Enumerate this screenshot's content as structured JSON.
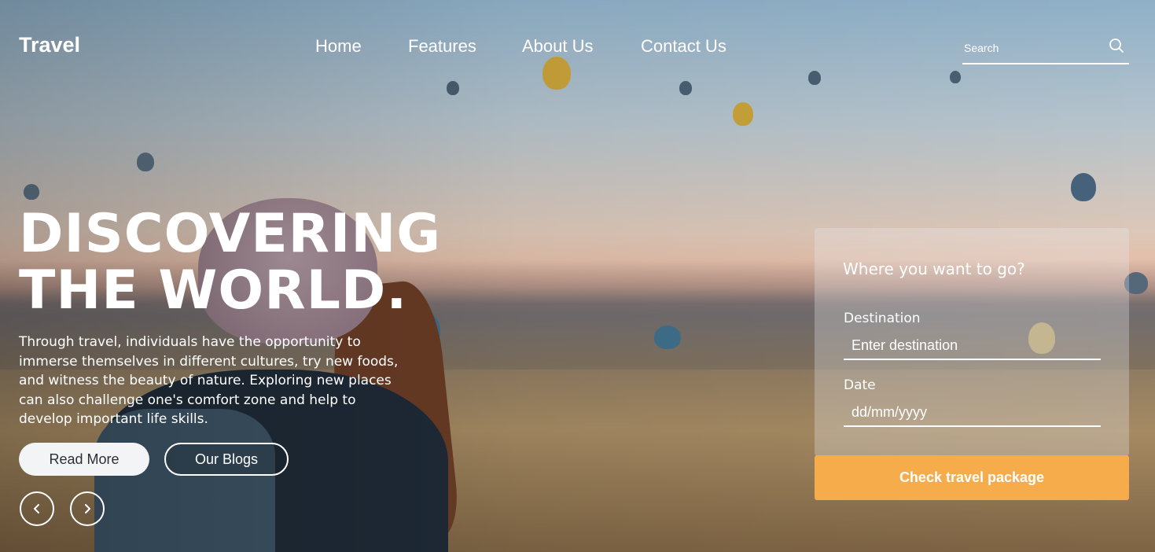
{
  "brand": {
    "logo": "Travel"
  },
  "nav": {
    "items": [
      "Home",
      "Features",
      "About Us",
      "Contact Us"
    ]
  },
  "search": {
    "placeholder": "Search"
  },
  "hero": {
    "headline_line1": "DISCOVERING",
    "headline_line2": "THE WORLD.",
    "description": "Through travel, individuals have the opportunity to immerse themselves in different cultures, try new foods, and witness the beauty of nature. Exploring new places can also challenge one's comfort zone and help to develop important life skills.",
    "read_more_label": "Read More",
    "blogs_label": "Our Blogs",
    "prev_icon": "chevron-left-icon",
    "next_icon": "chevron-right-icon"
  },
  "booking": {
    "title": "Where you want to go?",
    "destination_label": "Destination",
    "destination_placeholder": "Enter destination",
    "date_label": "Date",
    "date_placeholder": "dd/mm/yyyy",
    "submit_label": "Check travel package"
  },
  "colors": {
    "accent": "#f7ac4c",
    "text": "#ffffff",
    "panel": "rgba(235,236,240,0.30)"
  }
}
